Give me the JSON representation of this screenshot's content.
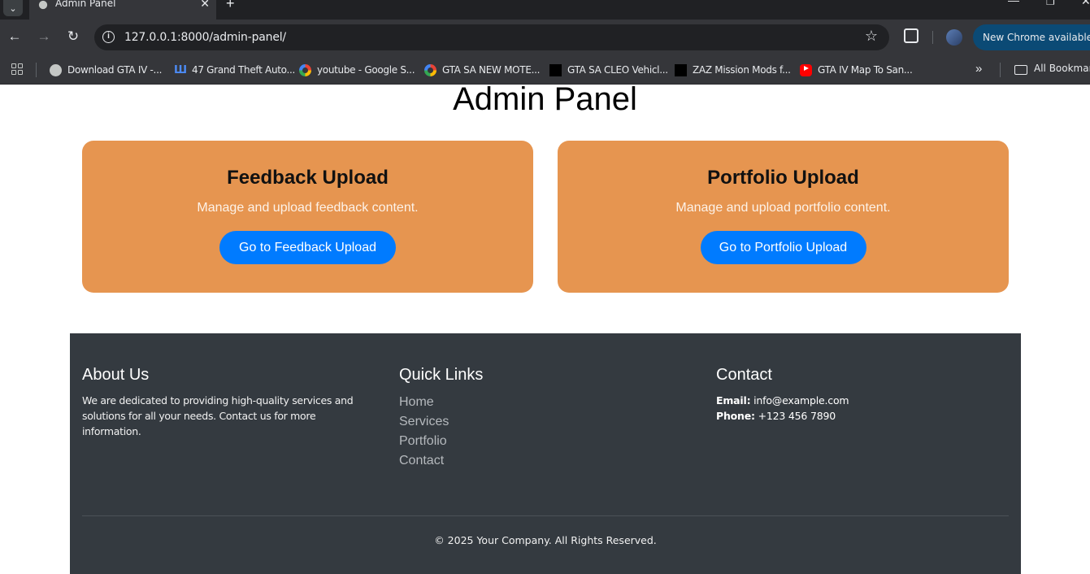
{
  "browser": {
    "tab_title": "Admin Panel",
    "url": "127.0.0.1:8000/admin-panel/",
    "update_label": "New Chrome available",
    "bookmarks": [
      {
        "label": "Download GTA IV -...",
        "icon": "globe-icon"
      },
      {
        "label": "47 Grand Theft Auto...",
        "icon": "w-icon"
      },
      {
        "label": "youtube - Google S...",
        "icon": "google-icon"
      },
      {
        "label": "GTA SA NEW MOTE...",
        "icon": "google-icon"
      },
      {
        "label": "GTA SA CLEO Vehicl...",
        "icon": "black-square-icon"
      },
      {
        "label": "ZAZ Mission Mods f...",
        "icon": "black-square-icon"
      },
      {
        "label": "GTA IV Map To San...",
        "icon": "youtube-icon"
      }
    ],
    "all_bookmarks_label": "All Bookmarks"
  },
  "page": {
    "title": "Admin Panel",
    "cards": [
      {
        "heading": "Feedback Upload",
        "description": "Manage and upload feedback content.",
        "button": "Go to Feedback Upload"
      },
      {
        "heading": "Portfolio Upload",
        "description": "Manage and upload portfolio content.",
        "button": "Go to Portfolio Upload"
      }
    ]
  },
  "footer": {
    "about": {
      "heading": "About Us",
      "text": "We are dedicated to providing high-quality services and solutions for all your needs. Contact us for more information."
    },
    "quick_links": {
      "heading": "Quick Links",
      "links": [
        "Home",
        "Services",
        "Portfolio",
        "Contact"
      ]
    },
    "contact": {
      "heading": "Contact",
      "email_label": "Email:",
      "email": "info@example.com",
      "phone_label": "Phone:",
      "phone": "+123 456 7890"
    },
    "copyright": "© 2025 Your Company. All Rights Reserved."
  },
  "colors": {
    "card_bg": "#e69550",
    "button_bg": "#007bff",
    "footer_bg": "#343a40"
  }
}
